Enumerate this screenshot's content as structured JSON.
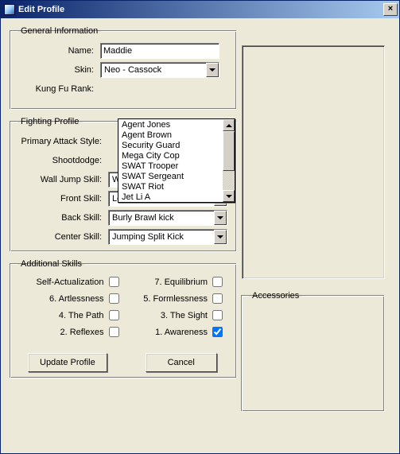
{
  "window": {
    "title": "Edit Profile"
  },
  "general": {
    "legend": "General Information",
    "name_label": "Name:",
    "name_value": "Maddie",
    "skin_label": "Skin:",
    "skin_value": "Neo - Cassock",
    "rank_label": "Kung Fu Rank:",
    "skin_options": [
      "Agent Jones",
      "Agent Brown",
      "Security Guard",
      "Mega City Cop",
      "SWAT Trooper",
      "SWAT Sergeant",
      "SWAT Riot",
      "Jet Li A"
    ]
  },
  "fighting": {
    "legend": "Fighting Profile",
    "primary_label": "Primary Attack Style:",
    "shootdodge_label": "Shootdodge:",
    "walljump_label": "Wall Jump Skill:",
    "walljump_value": "Wall kick",
    "front_label": "Front Skill:",
    "front_value": "Lobby kick",
    "back_label": "Back Skill:",
    "back_value": "Burly Brawl kick",
    "center_label": "Center Skill:",
    "center_value": "Jumping Split Kick"
  },
  "skills": {
    "legend": "Additional Skills",
    "items": [
      {
        "left": "Self-Actualization",
        "left_checked": false,
        "right": "7. Equilibrium",
        "right_checked": false
      },
      {
        "left": "6. Artlessness",
        "left_checked": false,
        "right": "5. Formlessness",
        "right_checked": false
      },
      {
        "left": "4. The Path",
        "left_checked": false,
        "right": "3. The Sight",
        "right_checked": false
      },
      {
        "left": "2. Reflexes",
        "left_checked": false,
        "right": "1. Awareness",
        "right_checked": true
      }
    ]
  },
  "accessories": {
    "legend": "Accessories"
  },
  "buttons": {
    "update": "Update Profile",
    "cancel": "Cancel"
  }
}
